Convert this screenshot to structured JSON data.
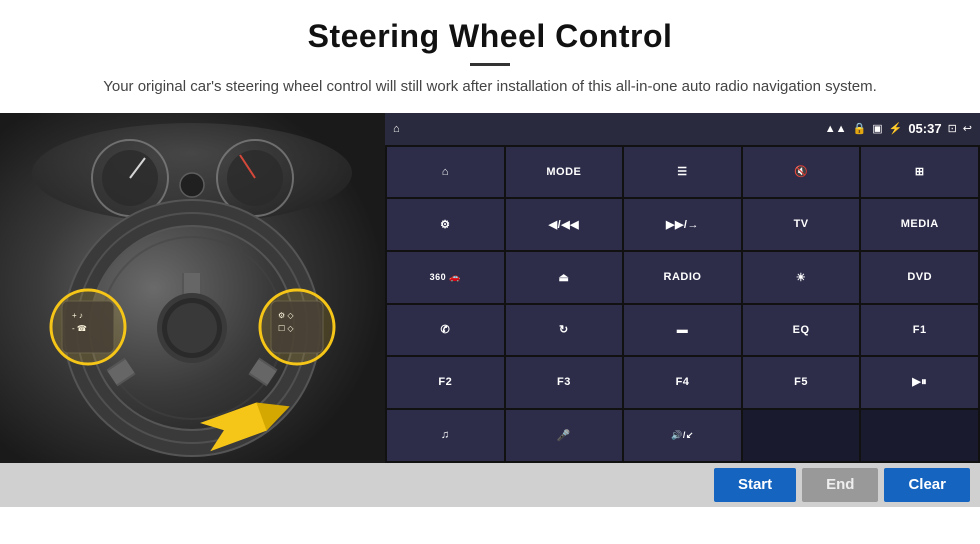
{
  "header": {
    "title": "Steering Wheel Control",
    "description": "Your original car's steering wheel control will still work after installation of this all-in-one auto radio navigation system."
  },
  "status_bar": {
    "time": "05:37",
    "icons": [
      "wifi",
      "lock",
      "sim",
      "bluetooth",
      "mirror",
      "back"
    ]
  },
  "button_grid": [
    {
      "id": "home",
      "label": "",
      "icon": "home",
      "type": "icon"
    },
    {
      "id": "mode",
      "label": "MODE",
      "icon": "",
      "type": "text"
    },
    {
      "id": "menu",
      "label": "",
      "icon": "menu",
      "type": "icon"
    },
    {
      "id": "mute",
      "label": "",
      "icon": "mute",
      "type": "icon"
    },
    {
      "id": "apps",
      "label": "",
      "icon": "apps",
      "type": "icon"
    },
    {
      "id": "settings",
      "label": "",
      "icon": "settings",
      "type": "icon"
    },
    {
      "id": "prev",
      "label": "",
      "icon": "prev",
      "type": "icon"
    },
    {
      "id": "next",
      "label": "",
      "icon": "next",
      "type": "icon"
    },
    {
      "id": "tv",
      "label": "TV",
      "icon": "",
      "type": "text"
    },
    {
      "id": "media",
      "label": "MEDIA",
      "icon": "",
      "type": "text"
    },
    {
      "id": "360",
      "label": "360",
      "icon": "",
      "type": "text"
    },
    {
      "id": "eject",
      "label": "",
      "icon": "eject",
      "type": "icon"
    },
    {
      "id": "radio",
      "label": "RADIO",
      "icon": "",
      "type": "text"
    },
    {
      "id": "brightness",
      "label": "",
      "icon": "brightness",
      "type": "icon"
    },
    {
      "id": "dvd",
      "label": "DVD",
      "icon": "",
      "type": "text"
    },
    {
      "id": "phone",
      "label": "",
      "icon": "phone",
      "type": "icon"
    },
    {
      "id": "loop",
      "label": "",
      "icon": "loop",
      "type": "icon"
    },
    {
      "id": "rect",
      "label": "",
      "icon": "rect",
      "type": "icon"
    },
    {
      "id": "eq",
      "label": "EQ",
      "icon": "",
      "type": "text"
    },
    {
      "id": "f1",
      "label": "F1",
      "icon": "",
      "type": "text"
    },
    {
      "id": "f2",
      "label": "F2",
      "icon": "",
      "type": "text"
    },
    {
      "id": "f3",
      "label": "F3",
      "icon": "",
      "type": "text"
    },
    {
      "id": "f4",
      "label": "F4",
      "icon": "",
      "type": "text"
    },
    {
      "id": "f5",
      "label": "F5",
      "icon": "",
      "type": "text"
    },
    {
      "id": "playpause",
      "label": "",
      "icon": "playpause",
      "type": "icon"
    },
    {
      "id": "music",
      "label": "",
      "icon": "music",
      "type": "icon"
    },
    {
      "id": "mic",
      "label": "",
      "icon": "mic",
      "type": "icon"
    },
    {
      "id": "sound",
      "label": "",
      "icon": "sound",
      "type": "icon"
    },
    {
      "id": "empty1",
      "label": "",
      "icon": "",
      "type": "empty"
    },
    {
      "id": "empty2",
      "label": "",
      "icon": "",
      "type": "empty"
    }
  ],
  "action_bar": {
    "start_label": "Start",
    "end_label": "End",
    "clear_label": "Clear"
  }
}
